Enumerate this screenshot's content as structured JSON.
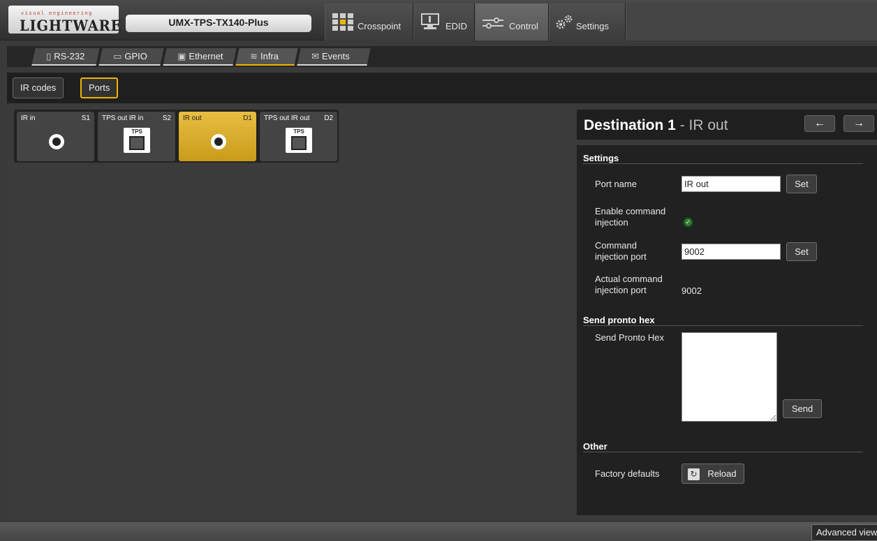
{
  "header": {
    "logo_tag": "visual engineering",
    "logo_name": "LIGHTWARE",
    "device_name": "UMX-TPS-TX140-Plus",
    "nav": [
      {
        "label": "Crosspoint",
        "icon": "grid-icon"
      },
      {
        "label": "EDID",
        "icon": "monitor-icon"
      },
      {
        "label": "Control",
        "icon": "sliders-icon",
        "active": true
      },
      {
        "label": "Settings",
        "icon": "gears-icon"
      }
    ]
  },
  "subtabs": [
    {
      "label": "RS-232",
      "icon": "serial-icon"
    },
    {
      "label": "GPIO",
      "icon": "gpio-icon"
    },
    {
      "label": "Ethernet",
      "icon": "ethernet-icon"
    },
    {
      "label": "Infra",
      "icon": "wifi-icon",
      "active": true
    },
    {
      "label": "Events",
      "icon": "events-icon"
    }
  ],
  "buttons": {
    "ir_codes": "IR codes",
    "ports": "Ports"
  },
  "ports": [
    {
      "name": "IR in",
      "id": "S1",
      "type": "jack"
    },
    {
      "name": "TPS out IR in",
      "id": "S2",
      "type": "tps"
    },
    {
      "name": "IR out",
      "id": "D1",
      "type": "jack",
      "selected": true
    },
    {
      "name": "TPS out IR out",
      "id": "D2",
      "type": "tps"
    }
  ],
  "tps_label": "TPS",
  "panel": {
    "title": "Destination 1",
    "separator": " - ",
    "subtitle": "IR out",
    "prev_arrow": "←",
    "next_arrow": "→"
  },
  "settings": {
    "section": "Settings",
    "port_name_label": "Port name",
    "port_name_value": "IR out",
    "enable_label_1": "Enable command",
    "enable_label_2": "injection",
    "cmd_port_label_1": "Command",
    "cmd_port_label_2": "injection port",
    "cmd_port_value": "9002",
    "actual_label_1": "Actual command",
    "actual_label_2": "injection port",
    "actual_value": "9002",
    "set_label": "Set"
  },
  "pronto": {
    "section": "Send pronto hex",
    "label": "Send Pronto Hex",
    "send_label": "Send"
  },
  "other": {
    "section": "Other",
    "factory_label": "Factory defaults",
    "reload_label": "Reload"
  },
  "footer": {
    "advanced": "Advanced view"
  }
}
